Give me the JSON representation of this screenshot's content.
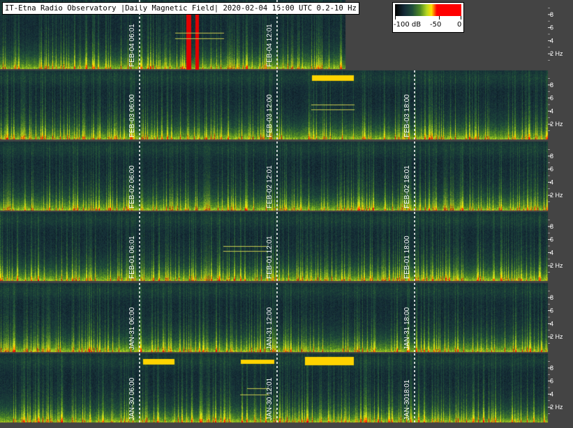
{
  "title": "IT-Etna Radio Observatory |Daily Magnetic Field| 2020-02-04 15:00 UTC 0.2-10 Hz",
  "colorbar": {
    "labels": [
      "-100 dB",
      "-50",
      "0"
    ],
    "range_db": [
      -100,
      0
    ],
    "colors": [
      "#000000",
      "#1f4d3a",
      "#b8d820",
      "#ffe000",
      "#ff0000"
    ]
  },
  "chart_data": {
    "type": "heatmap",
    "title": "IT-Etna Radio Observatory |Daily Magnetic Field| 2020-02-04 15:00 UTC 0.2-10 Hz",
    "frequency_range_hz": [
      0.2,
      10
    ],
    "frequency_tick_labels": [
      "8",
      "6",
      "4",
      "2 Hz"
    ],
    "frequency_ticks_hz": [
      8,
      6,
      4,
      2
    ],
    "colorbar_range_db": [
      -100,
      0
    ],
    "rows": [
      {
        "day": "FEB-04",
        "markers": [
          "FEB-04 06:01",
          "FEB-04 12:01"
        ],
        "partial": true
      },
      {
        "day": "FEB-03",
        "markers": [
          "FEB-03 06:00",
          "FEB-03 12:00",
          "FEB-03 18:00"
        ]
      },
      {
        "day": "FEB-02",
        "markers": [
          "FEB-02 06:00",
          "FEB-02 12:01",
          "FEB-02 18:01"
        ]
      },
      {
        "day": "FEB-01",
        "markers": [
          "FEB-01 06:01",
          "FEB-01 12:01",
          "FEB-01 18:00"
        ]
      },
      {
        "day": "JAN-31",
        "markers": [
          "JAN-31 06:00",
          "JAN-31 12:00",
          "JAN-31 18:00"
        ]
      },
      {
        "day": "JAN-30",
        "markers": [
          "JAN-30 06:00",
          "JAN-30 12:01",
          "JAN-3018:01"
        ]
      }
    ]
  }
}
